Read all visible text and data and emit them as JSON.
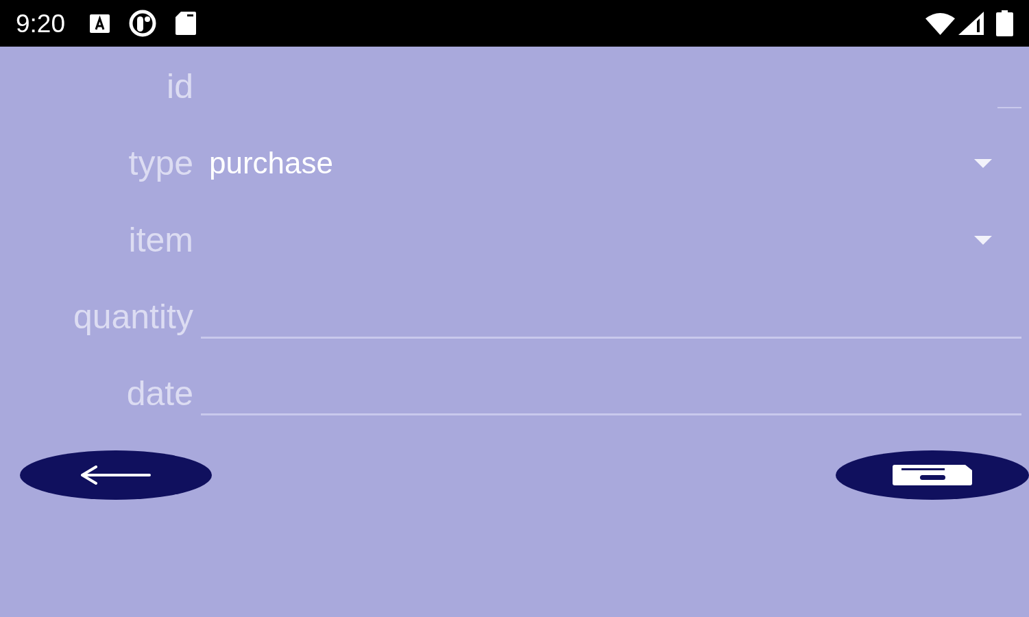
{
  "status_bar": {
    "time": "9:20"
  },
  "form": {
    "fields": [
      {
        "label": "id",
        "kind": "short_input"
      },
      {
        "label": "type",
        "kind": "dropdown",
        "value": "purchase"
      },
      {
        "label": "item",
        "kind": "dropdown"
      },
      {
        "label": "quantity",
        "kind": "input"
      },
      {
        "label": "date",
        "kind": "input"
      }
    ]
  }
}
